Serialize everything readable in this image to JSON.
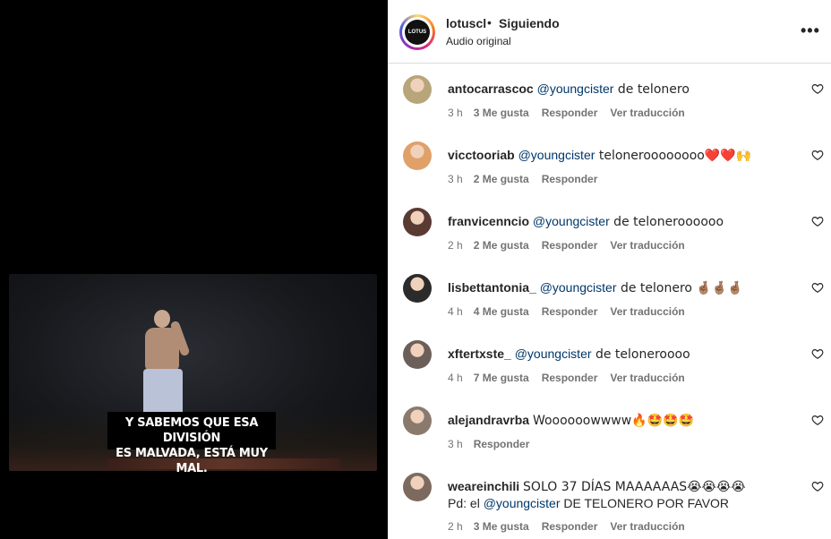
{
  "video": {
    "subtitle_line1": "Y SABEMOS QUE ESA DIVISIÓN",
    "subtitle_line2": "ES MALVADA, ESTÁ MUY MAL."
  },
  "header": {
    "logo_text": "LOTUS",
    "username": "lotuscl",
    "separator": "•",
    "follow_status": "Siguiendo",
    "audio": "Audio original",
    "more": "•••"
  },
  "comments": [
    {
      "user": "antocarrascoc",
      "mention": "@youngcister",
      "text": " de telonero",
      "extra_line_mention": "",
      "extra_line_text": "",
      "time": "3 h",
      "likes": "3 Me gusta",
      "reply": "Responder",
      "translate": "Ver traducción",
      "avatar_color": "#b8a57a"
    },
    {
      "user": "vicctooriab",
      "mention": "@youngcister",
      "text": " teloneroooooooo❤️❤️🙌",
      "extra_line_mention": "",
      "extra_line_text": "",
      "time": "3 h",
      "likes": "2 Me gusta",
      "reply": "Responder",
      "translate": "",
      "avatar_color": "#e0a06a"
    },
    {
      "user": "franvicenncio",
      "mention": "@youngcister",
      "text": " de teloneroooooo",
      "extra_line_mention": "",
      "extra_line_text": "",
      "time": "2 h",
      "likes": "2 Me gusta",
      "reply": "Responder",
      "translate": "Ver traducción",
      "avatar_color": "#5a3b34"
    },
    {
      "user": "lisbettantonia_",
      "mention": "@youngcister",
      "text": " de telonero 🤞🏽🤞🏽🤞🏽",
      "extra_line_mention": "",
      "extra_line_text": "",
      "time": "4 h",
      "likes": "4 Me gusta",
      "reply": "Responder",
      "translate": "Ver traducción",
      "avatar_color": "#2b2b2b"
    },
    {
      "user": "xftertxste_",
      "mention": "@youngcister",
      "text": " de teloneroooo",
      "extra_line_mention": "",
      "extra_line_text": "",
      "time": "4 h",
      "likes": "7 Me gusta",
      "reply": "Responder",
      "translate": "Ver traducción",
      "avatar_color": "#6c5f5a"
    },
    {
      "user": "alejandravrba",
      "mention": "",
      "text": " Woooooowwww🔥🤩🤩🤩",
      "extra_line_mention": "",
      "extra_line_text": "",
      "time": "3 h",
      "likes": "",
      "reply": "Responder",
      "translate": "",
      "avatar_color": "#8a7a6e"
    },
    {
      "user": "weareinchili",
      "mention": "",
      "text": " SOLO 37 DÍAS MAAAAAAS😭😭😭😭",
      "extra_line_prefix": "Pd: el ",
      "extra_line_mention": "@youngcister",
      "extra_line_text": " DE TELONERO POR FAVOR",
      "time": "2 h",
      "likes": "3 Me gusta",
      "reply": "Responder",
      "translate": "Ver traducción",
      "avatar_color": "#7d6a5e"
    }
  ],
  "colors": {
    "mention": "#00376b",
    "meta": "#737373",
    "divider": "#dbdbdb"
  },
  "icons": {
    "like": "heart-outline-icon",
    "more": "more-horizontal-icon"
  }
}
